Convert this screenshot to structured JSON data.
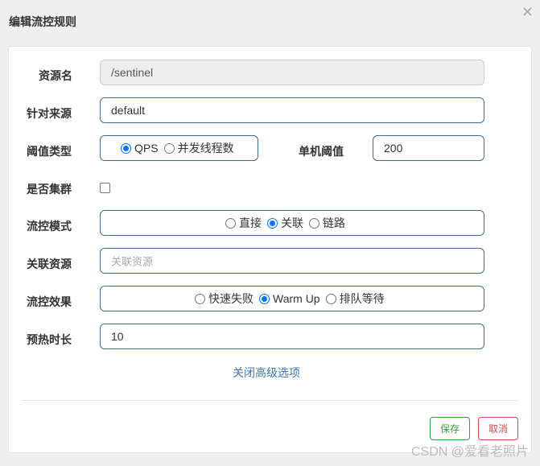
{
  "dialog": {
    "title": "编辑流控规则"
  },
  "form": {
    "resource": {
      "label": "资源名",
      "value": "/sentinel"
    },
    "limitApp": {
      "label": "针对来源",
      "value": "default"
    },
    "grade": {
      "label": "阈值类型",
      "options": [
        "QPS",
        "并发线程数"
      ],
      "selected": "QPS"
    },
    "threshold": {
      "label": "单机阈值",
      "value": "200"
    },
    "cluster": {
      "label": "是否集群",
      "checked": false
    },
    "strategy": {
      "label": "流控模式",
      "options": [
        "直接",
        "关联",
        "链路"
      ],
      "selected": "关联"
    },
    "refResource": {
      "label": "关联资源",
      "placeholder": "关联资源",
      "value": ""
    },
    "controlBehavior": {
      "label": "流控效果",
      "options": [
        "快速失败",
        "Warm Up",
        "排队等待"
      ],
      "selected": "Warm Up"
    },
    "warmUp": {
      "label": "预热时长",
      "value": "10"
    },
    "advanced_link": "关闭高级选项"
  },
  "footer": {
    "save_label": "保存",
    "cancel_label": "取消"
  },
  "watermark": "CSDN @爱看老照片"
}
